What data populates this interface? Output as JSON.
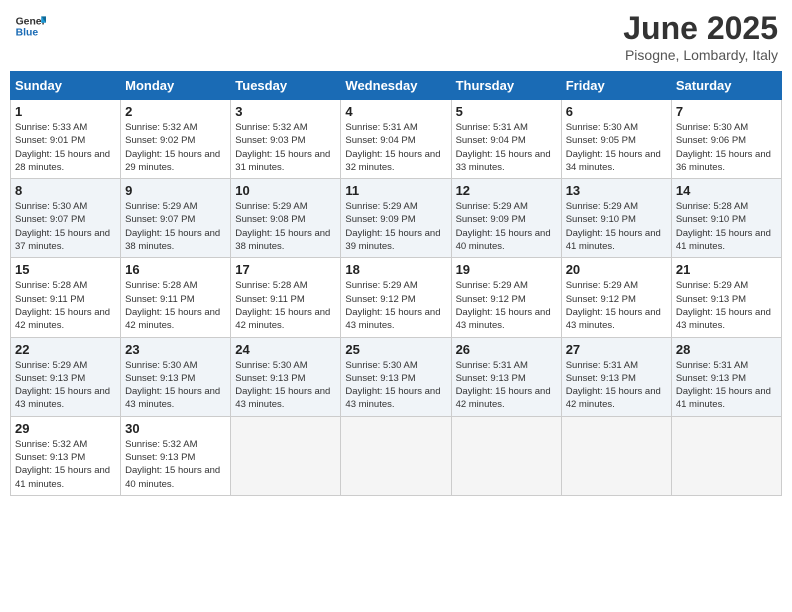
{
  "header": {
    "logo_line1": "General",
    "logo_line2": "Blue",
    "month": "June 2025",
    "location": "Pisogne, Lombardy, Italy"
  },
  "weekdays": [
    "Sunday",
    "Monday",
    "Tuesday",
    "Wednesday",
    "Thursday",
    "Friday",
    "Saturday"
  ],
  "weeks": [
    [
      {
        "day": 1,
        "sunrise": "5:33 AM",
        "sunset": "9:01 PM",
        "daylight": "15 hours and 28 minutes."
      },
      {
        "day": 2,
        "sunrise": "5:32 AM",
        "sunset": "9:02 PM",
        "daylight": "15 hours and 29 minutes."
      },
      {
        "day": 3,
        "sunrise": "5:32 AM",
        "sunset": "9:03 PM",
        "daylight": "15 hours and 31 minutes."
      },
      {
        "day": 4,
        "sunrise": "5:31 AM",
        "sunset": "9:04 PM",
        "daylight": "15 hours and 32 minutes."
      },
      {
        "day": 5,
        "sunrise": "5:31 AM",
        "sunset": "9:04 PM",
        "daylight": "15 hours and 33 minutes."
      },
      {
        "day": 6,
        "sunrise": "5:30 AM",
        "sunset": "9:05 PM",
        "daylight": "15 hours and 34 minutes."
      },
      {
        "day": 7,
        "sunrise": "5:30 AM",
        "sunset": "9:06 PM",
        "daylight": "15 hours and 36 minutes."
      }
    ],
    [
      {
        "day": 8,
        "sunrise": "5:30 AM",
        "sunset": "9:07 PM",
        "daylight": "15 hours and 37 minutes."
      },
      {
        "day": 9,
        "sunrise": "5:29 AM",
        "sunset": "9:07 PM",
        "daylight": "15 hours and 38 minutes."
      },
      {
        "day": 10,
        "sunrise": "5:29 AM",
        "sunset": "9:08 PM",
        "daylight": "15 hours and 38 minutes."
      },
      {
        "day": 11,
        "sunrise": "5:29 AM",
        "sunset": "9:09 PM",
        "daylight": "15 hours and 39 minutes."
      },
      {
        "day": 12,
        "sunrise": "5:29 AM",
        "sunset": "9:09 PM",
        "daylight": "15 hours and 40 minutes."
      },
      {
        "day": 13,
        "sunrise": "5:29 AM",
        "sunset": "9:10 PM",
        "daylight": "15 hours and 41 minutes."
      },
      {
        "day": 14,
        "sunrise": "5:28 AM",
        "sunset": "9:10 PM",
        "daylight": "15 hours and 41 minutes."
      }
    ],
    [
      {
        "day": 15,
        "sunrise": "5:28 AM",
        "sunset": "9:11 PM",
        "daylight": "15 hours and 42 minutes."
      },
      {
        "day": 16,
        "sunrise": "5:28 AM",
        "sunset": "9:11 PM",
        "daylight": "15 hours and 42 minutes."
      },
      {
        "day": 17,
        "sunrise": "5:28 AM",
        "sunset": "9:11 PM",
        "daylight": "15 hours and 42 minutes."
      },
      {
        "day": 18,
        "sunrise": "5:29 AM",
        "sunset": "9:12 PM",
        "daylight": "15 hours and 43 minutes."
      },
      {
        "day": 19,
        "sunrise": "5:29 AM",
        "sunset": "9:12 PM",
        "daylight": "15 hours and 43 minutes."
      },
      {
        "day": 20,
        "sunrise": "5:29 AM",
        "sunset": "9:12 PM",
        "daylight": "15 hours and 43 minutes."
      },
      {
        "day": 21,
        "sunrise": "5:29 AM",
        "sunset": "9:13 PM",
        "daylight": "15 hours and 43 minutes."
      }
    ],
    [
      {
        "day": 22,
        "sunrise": "5:29 AM",
        "sunset": "9:13 PM",
        "daylight": "15 hours and 43 minutes."
      },
      {
        "day": 23,
        "sunrise": "5:30 AM",
        "sunset": "9:13 PM",
        "daylight": "15 hours and 43 minutes."
      },
      {
        "day": 24,
        "sunrise": "5:30 AM",
        "sunset": "9:13 PM",
        "daylight": "15 hours and 43 minutes."
      },
      {
        "day": 25,
        "sunrise": "5:30 AM",
        "sunset": "9:13 PM",
        "daylight": "15 hours and 43 minutes."
      },
      {
        "day": 26,
        "sunrise": "5:31 AM",
        "sunset": "9:13 PM",
        "daylight": "15 hours and 42 minutes."
      },
      {
        "day": 27,
        "sunrise": "5:31 AM",
        "sunset": "9:13 PM",
        "daylight": "15 hours and 42 minutes."
      },
      {
        "day": 28,
        "sunrise": "5:31 AM",
        "sunset": "9:13 PM",
        "daylight": "15 hours and 41 minutes."
      }
    ],
    [
      {
        "day": 29,
        "sunrise": "5:32 AM",
        "sunset": "9:13 PM",
        "daylight": "15 hours and 41 minutes."
      },
      {
        "day": 30,
        "sunrise": "5:32 AM",
        "sunset": "9:13 PM",
        "daylight": "15 hours and 40 minutes."
      },
      null,
      null,
      null,
      null,
      null
    ]
  ]
}
